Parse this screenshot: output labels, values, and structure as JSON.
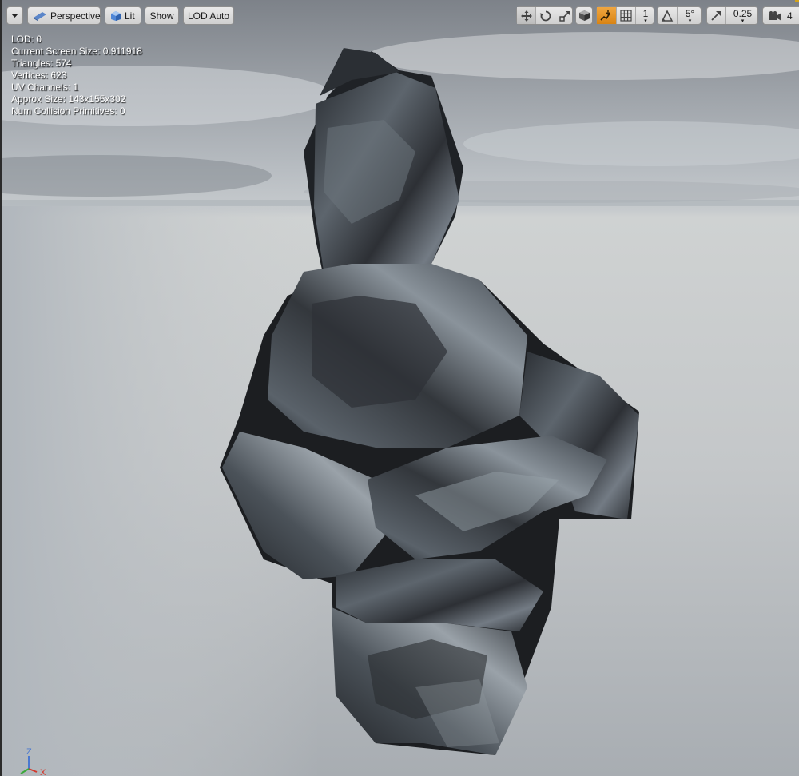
{
  "toolbar": {
    "options_menu_icon": "chevron-down-icon",
    "perspective_label": "Perspective",
    "lit_label": "Lit",
    "show_label": "Show",
    "lod_label": "LOD Auto",
    "translate_icon": "move-icon",
    "rotate_icon": "rotate-icon",
    "scale_icon": "scale-icon",
    "coord_icon": "world-cube-icon",
    "surface_snap_icon": "surface-snap-icon",
    "grid_snap_icon": "grid-icon",
    "grid_snap_value": "1",
    "rotation_snap_icon": "angle-icon",
    "rotation_snap_value": "5°",
    "scale_snap_icon": "scale-arrow-icon",
    "scale_snap_value": "0.25",
    "camera_speed_icon": "camera-icon",
    "camera_speed_value": "4"
  },
  "stats": {
    "lod": "LOD:  0",
    "screen_size": "Current Screen Size:  0.911918",
    "triangles": "Triangles:  574",
    "vertices": "Vertices:  623",
    "uv_channels": "UV Channels:  1",
    "approx_size": "Approx Size: 143x155x302",
    "collision": "Num Collision Primitives:  0"
  },
  "axis": {
    "z_label": "Z",
    "x_label": "X"
  },
  "colors": {
    "active_toggle": "#e8961f",
    "sky_top": "#7c8189",
    "horizon": "#b5b9be",
    "floor": "#cfd1d1",
    "rock_dark": "#25282c",
    "rock_light": "#8c949c",
    "axis_z": "#4a78d0",
    "axis_x": "#d23a2e",
    "axis_y": "#3aa83a"
  }
}
